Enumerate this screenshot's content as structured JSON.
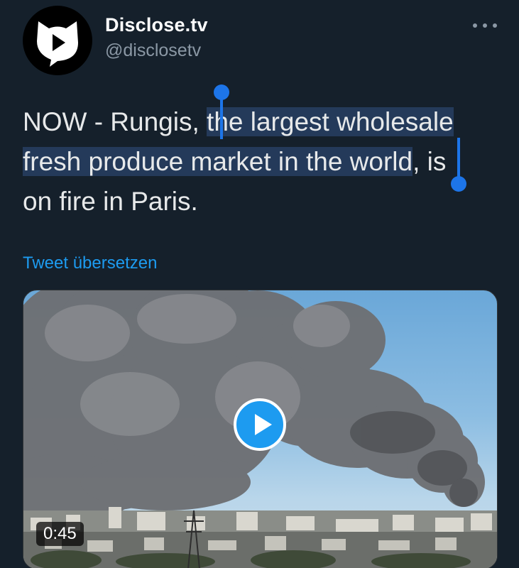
{
  "author": {
    "display_name": "Disclose.tv",
    "handle": "@disclosetv",
    "avatar_icon": "fox-play-logo-icon"
  },
  "menu": {
    "more_icon": "more-horizontal-icon"
  },
  "tweet": {
    "text_part1": "NOW - Rungis, ",
    "text_selected_line1": "the largest wholesale",
    "text_selected_line2": "fresh produce market in the world",
    "text_part2": ", is",
    "text_line3": "on fire in Paris.",
    "translate_label": "Tweet übersetzen"
  },
  "media": {
    "duration": "0:45",
    "play_icon": "play-icon"
  },
  "colors": {
    "background": "#15202b",
    "accent": "#1d9bf0",
    "selection": "#243a5a",
    "handle_color": "#1d75e9"
  }
}
